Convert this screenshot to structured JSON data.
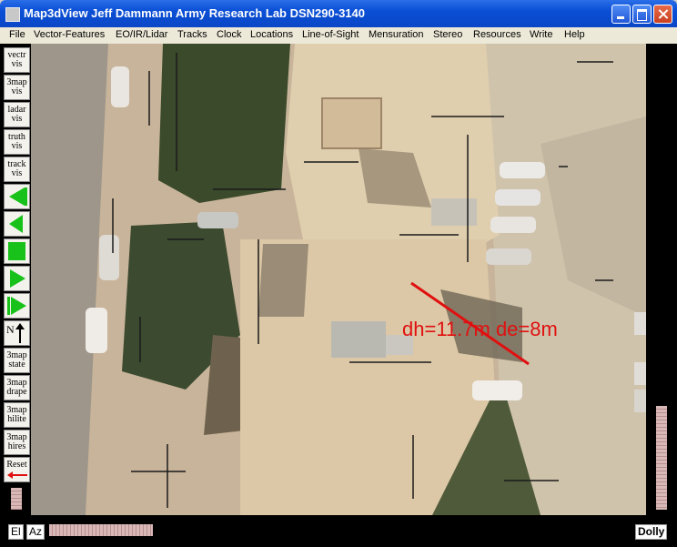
{
  "window": {
    "title": "Map3dView Jeff Dammann Army Research Lab DSN290-3140"
  },
  "menu": [
    "File",
    "Vector-Features",
    "EO/IR/Lidar",
    "Tracks",
    "Clock",
    "Locations",
    "Line-of-Sight",
    "Mensuration",
    "Stereo",
    "Resources",
    "Write",
    "Help"
  ],
  "toolbar": {
    "vectr_vis": "vectr vis",
    "map_vis": "3map vis",
    "ladar_vis": "ladar vis",
    "truth_vis": "truth vis",
    "track_vis": "track vis",
    "north_label": "N",
    "map_state": "3map state",
    "map_drape": "3map drape",
    "map_hilite": "3map hilite",
    "map_hires": "3map hires",
    "reset": "Reset"
  },
  "overlay": {
    "measurement": "dh=11.7m de=8m",
    "color": "#e01010"
  },
  "bottom": {
    "el": "El",
    "az": "Az",
    "dolly": "Dolly"
  },
  "colors": {
    "titlebar": "#0a4fd6",
    "play_green": "#19c21a"
  }
}
